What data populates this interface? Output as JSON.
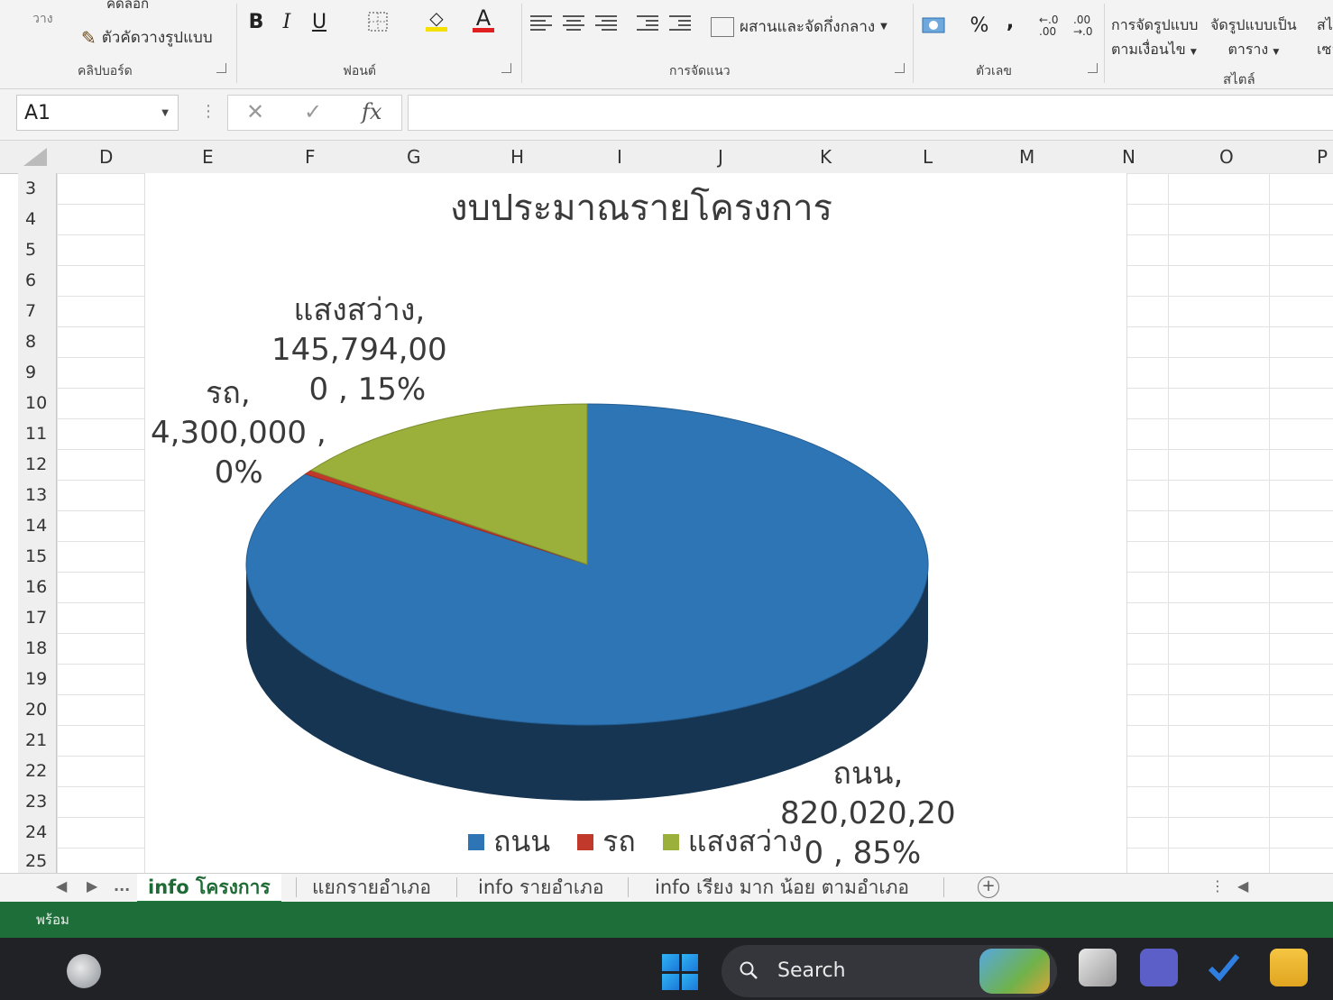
{
  "ribbon": {
    "paste_label": "วาง",
    "copy_label": "คัดลอก",
    "format_painter_label": "ตัวคัดวางรูปแบบ",
    "clipboard_group": "คลิปบอร์ด",
    "bold": "B",
    "italic": "I",
    "underline": "U",
    "font_color_glyph": "A",
    "font_group": "ฟอนต์",
    "merge_label": "ผสานและจัดกึ่งกลาง",
    "alignment_group": "การจัดแนว",
    "percent": "%",
    "comma": ",",
    "inc_decimal": "←.0 .00",
    "dec_decimal": ".00 →.0",
    "number_group": "ตัวเลข",
    "cond_format_label_1": "การจัดรูปแบบ",
    "cond_format_label_2": "ตามเงื่อนไข",
    "format_table_label_1": "จัดรูปแบบเป็น",
    "format_table_label_2": "ตาราง",
    "styles_group": "สไตล์",
    "cell_styles_label_1": "สไ",
    "cell_styles_label_2": "เซล"
  },
  "formula_bar": {
    "name_box": "A1",
    "cancel_glyph": "✕",
    "enter_glyph": "✓",
    "fx_glyph": "fx",
    "formula_value": ""
  },
  "columns": [
    "D",
    "E",
    "F",
    "G",
    "H",
    "I",
    "J",
    "K",
    "L",
    "M",
    "N",
    "O",
    "P"
  ],
  "rows": [
    "3",
    "4",
    "5",
    "6",
    "7",
    "8",
    "9",
    "10",
    "11",
    "12",
    "13",
    "14",
    "15",
    "16",
    "17",
    "18",
    "19",
    "20",
    "21",
    "22",
    "23",
    "24",
    "25"
  ],
  "chart_data": {
    "type": "pie",
    "title": "งบประมาณรายโครงการ",
    "categories": [
      "ถนน",
      "รถ",
      "แสงสว่าง"
    ],
    "values": [
      820020200,
      4300000,
      145794000
    ],
    "percent": [
      85,
      0,
      15
    ],
    "colors": [
      "#2e75b6",
      "#c0392b",
      "#9ab03a"
    ],
    "legend_position": "bottom",
    "three_d": true,
    "data_labels": [
      {
        "line1": "ถนน,",
        "line2": "820,020,20",
        "line3": "0 , 85%"
      },
      {
        "line1": "รถ,",
        "line2": "4,300,000 ,",
        "line3": "0%"
      },
      {
        "line1": "แสงสว่าง,",
        "line2": "145,794,00",
        "line3": "0 , 15%"
      }
    ]
  },
  "sheet_tabs": {
    "ellipsis": "...",
    "tabs": [
      "info โครงการ",
      "แยกรายอำเภอ",
      "info รายอำเภอ",
      "info เรียง มาก น้อย ตามอำเภอ"
    ],
    "active_index": 0,
    "add_glyph": "+"
  },
  "status_bar": {
    "text": "พร้อม"
  },
  "taskbar": {
    "search_label": "Search"
  }
}
